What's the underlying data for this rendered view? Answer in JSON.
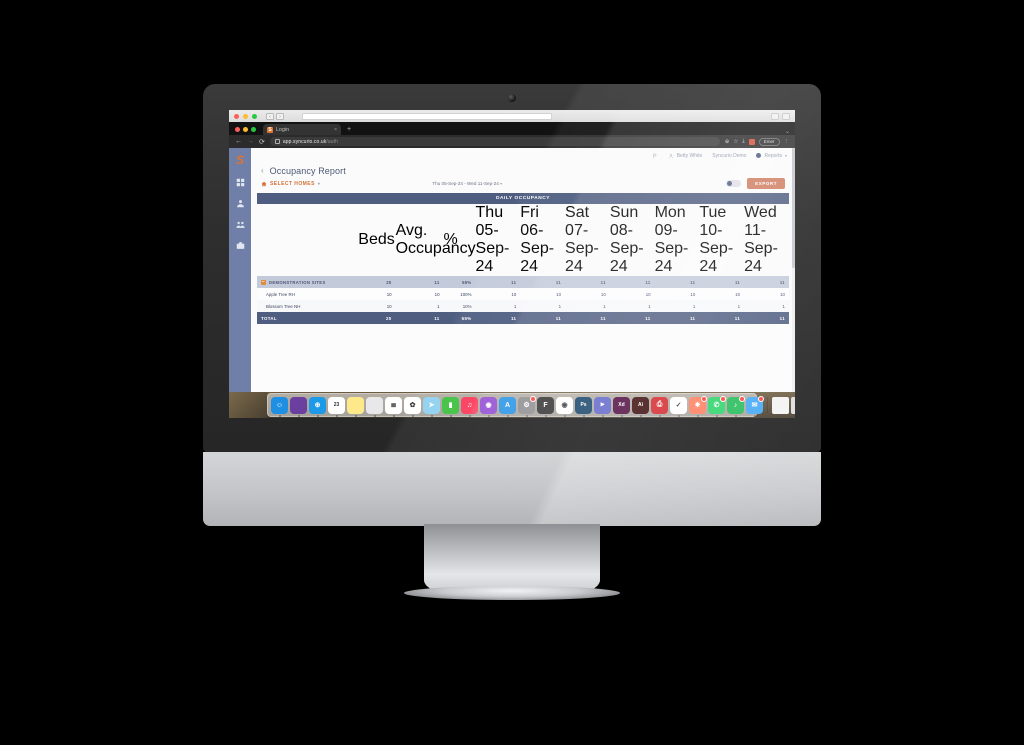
{
  "os": {
    "window_controls": [
      "close",
      "minimize",
      "maximize"
    ],
    "dock_apps": [
      {
        "name": "finder",
        "glyph": "☺",
        "color": "#1e8fe3"
      },
      {
        "name": "siri",
        "glyph": "",
        "color": "#6b3fa0"
      },
      {
        "name": "safari",
        "glyph": "⊕",
        "color": "#1c9ae8"
      },
      {
        "name": "calendar",
        "glyph": "23",
        "color": "#ffffff"
      },
      {
        "name": "notes",
        "glyph": "",
        "color": "#fee98a"
      },
      {
        "name": "photos-preview",
        "glyph": "",
        "color": "#e8e8ea"
      },
      {
        "name": "reminders",
        "glyph": "≣",
        "color": "#ffffff"
      },
      {
        "name": "photos",
        "glyph": "✿",
        "color": "#ffffff"
      },
      {
        "name": "maps",
        "glyph": "➤",
        "color": "#8fd0f0"
      },
      {
        "name": "numbers",
        "glyph": "▮",
        "color": "#3ec03e"
      },
      {
        "name": "music",
        "glyph": "♫",
        "color": "#fb3b5c"
      },
      {
        "name": "podcasts",
        "glyph": "◉",
        "color": "#8e44d0"
      },
      {
        "name": "app-store",
        "glyph": "A",
        "color": "#1e8fe3"
      },
      {
        "name": "system-settings",
        "glyph": "⚙",
        "color": "#8a8a8e"
      },
      {
        "name": "figma",
        "glyph": "F",
        "color": "#2c2c2c"
      },
      {
        "name": "chrome",
        "glyph": "◉",
        "color": "#ffffff"
      },
      {
        "name": "photoshop",
        "glyph": "Ps",
        "color": "#0d3c63"
      },
      {
        "name": "microsoft-teams",
        "glyph": "⫸",
        "color": "#5b5fc7"
      },
      {
        "name": "adobe-xd",
        "glyph": "Xd",
        "color": "#470137"
      },
      {
        "name": "illustrator",
        "glyph": "Ai",
        "color": "#330000"
      },
      {
        "name": "acrobat",
        "glyph": "⎙",
        "color": "#d21f24"
      },
      {
        "name": "vectorworks",
        "glyph": "✓",
        "color": "#ffffff"
      },
      {
        "name": "hubspot",
        "glyph": "✸",
        "color": "#ff7a59"
      },
      {
        "name": "whatsapp",
        "glyph": "✆",
        "color": "#25d366"
      },
      {
        "name": "spotify",
        "glyph": "♪",
        "color": "#1db954"
      },
      {
        "name": "mail",
        "glyph": "✉",
        "color": "#3da5f4"
      },
      {
        "name": "document",
        "glyph": "",
        "color": "#f2f2f2"
      },
      {
        "name": "trash",
        "glyph": "",
        "color": "#dcdcdc"
      }
    ]
  },
  "browser": {
    "tab": {
      "title": "Login",
      "favicon_letter": "S"
    },
    "new_tab_glyph": "+",
    "nav": {
      "back": "←",
      "forward": "→",
      "reload": "⟳"
    },
    "url": {
      "domain": "app.syncurio.co.uk",
      "path": "/auth"
    },
    "toolbar_right": {
      "zoom_label": "⊕",
      "bookmark": "☆",
      "downloads": "⤓",
      "profile_label": "Emer"
    }
  },
  "sidebar": {
    "logo": "S",
    "items": [
      {
        "name": "dashboard",
        "icon": "grid-icon"
      },
      {
        "name": "people",
        "icon": "person-icon"
      },
      {
        "name": "staff",
        "icon": "group-icon"
      },
      {
        "name": "business",
        "icon": "briefcase-icon"
      }
    ]
  },
  "topbar": {
    "flag_label": "flag-icon",
    "user": "Betty White",
    "organisation": "Syncurio Demo",
    "reports": "Reports",
    "caret": "▾"
  },
  "page": {
    "back": "‹",
    "title": "Occupancy Report",
    "select_homes": "SELECT HOMES",
    "select_homes_caret": "▾",
    "date_range": "Thu 05-Sep-24 - Wed 11-Sep-24",
    "date_range_caret": "▾",
    "toggle_state": "on",
    "export_label": "EXPORT"
  },
  "table": {
    "title": "DAILY OCCUPANCY",
    "columns": [
      {
        "key": "name",
        "label": "",
        "align": "left"
      },
      {
        "key": "beds",
        "label": "Beds",
        "align": "right"
      },
      {
        "key": "avg",
        "label": "Avg. Occupancy",
        "align": "right"
      },
      {
        "key": "pct",
        "label": "%",
        "align": "right"
      },
      {
        "key": "d1",
        "label": "Thu 05-Sep-24",
        "align": "right"
      },
      {
        "key": "d2",
        "label": "Fri 06-Sep-24",
        "align": "right"
      },
      {
        "key": "d3",
        "label": "Sat 07-Sep-24",
        "align": "right"
      },
      {
        "key": "d4",
        "label": "Sun 08-Sep-24",
        "align": "right"
      },
      {
        "key": "d5",
        "label": "Mon 09-Sep-24",
        "align": "right"
      },
      {
        "key": "d6",
        "label": "Tue 10-Sep-24",
        "align": "right"
      },
      {
        "key": "d7",
        "label": "Wed 11-Sep-24",
        "align": "right"
      }
    ],
    "rows": [
      {
        "type": "group",
        "expander": "−",
        "name": "DEMONSTRATION SITES",
        "beds": "20",
        "avg": "11",
        "pct": "55%",
        "d1": "11",
        "d2": "11",
        "d3": "11",
        "d4": "11",
        "d5": "11",
        "d6": "11",
        "d7": "11"
      },
      {
        "type": "child",
        "name": "Apple Tree RH",
        "beds": "10",
        "avg": "10",
        "pct": "100%",
        "d1": "10",
        "d2": "10",
        "d3": "10",
        "d4": "10",
        "d5": "10",
        "d6": "10",
        "d7": "10"
      },
      {
        "type": "child",
        "name": "Blossom Tree NH",
        "beds": "10",
        "avg": "1",
        "pct": "10%",
        "d1": "1",
        "d2": "1",
        "d3": "1",
        "d4": "1",
        "d5": "1",
        "d6": "1",
        "d7": "1"
      },
      {
        "type": "total",
        "name": "TOTAL",
        "beds": "20",
        "avg": "11",
        "pct": "55%",
        "d1": "11",
        "d2": "11",
        "d3": "11",
        "d4": "11",
        "d5": "11",
        "d6": "11",
        "d7": "11"
      }
    ]
  },
  "colors": {
    "brand_orange": "#e0742f",
    "header_blue": "#4e5d80",
    "subheader_blue": "#8a95ae",
    "group_row": "#c3cada",
    "sidebar": "#6f7fa8",
    "export_button": "#cf7b5e"
  }
}
